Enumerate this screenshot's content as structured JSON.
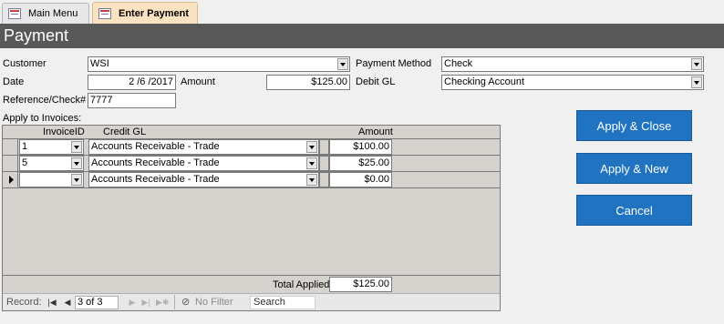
{
  "tabs": [
    {
      "label": "Main Menu"
    },
    {
      "label": "Enter Payment"
    }
  ],
  "header": {
    "title": "Payment"
  },
  "form": {
    "customer_label": "Customer",
    "customer_value": "WSI",
    "date_label": "Date",
    "date_value": "2 /6 /2017",
    "amount_label": "Amount",
    "amount_value": "$125.00",
    "reference_label": "Reference/Check#",
    "reference_value": "7777",
    "payment_method_label": "Payment Method",
    "payment_method_value": "Check",
    "debit_gl_label": "Debit GL",
    "debit_gl_value": "Checking Account",
    "apply_label": "Apply to Invoices:"
  },
  "grid": {
    "columns": {
      "invoice": "InvoiceID",
      "credit_gl": "Credit GL",
      "amount": "Amount"
    },
    "rows": [
      {
        "invoice": "1",
        "credit_gl": "Accounts Receivable - Trade",
        "amount": "$100.00"
      },
      {
        "invoice": "5",
        "credit_gl": "Accounts Receivable - Trade",
        "amount": "$25.00"
      },
      {
        "invoice": "",
        "credit_gl": "Accounts Receivable - Trade",
        "amount": "$0.00"
      }
    ],
    "total_label": "Total Applied",
    "total_value": "$125.00"
  },
  "navigation": {
    "record_label": "Record:",
    "position": "3 of 3",
    "no_filter": "No Filter",
    "search": "Search"
  },
  "buttons": {
    "apply_close": "Apply & Close",
    "apply_new": "Apply & New",
    "cancel": "Cancel"
  },
  "colors": {
    "header_bg": "#595959",
    "button_bg": "#1f73c0",
    "active_tab": "#fbe3c2",
    "subform_bg": "#d6d3ce"
  }
}
